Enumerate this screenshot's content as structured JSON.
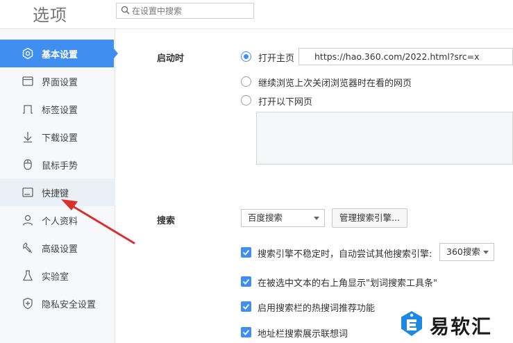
{
  "header": {
    "title": "选项",
    "search_placeholder": "在设置中搜索"
  },
  "sidebar": {
    "items": [
      {
        "label": "基本设置",
        "icon": "gear-icon"
      },
      {
        "label": "界面设置",
        "icon": "window-icon"
      },
      {
        "label": "标签设置",
        "icon": "tab-icon"
      },
      {
        "label": "下载设置",
        "icon": "download-icon"
      },
      {
        "label": "鼠标手势",
        "icon": "mouse-icon"
      },
      {
        "label": "快捷键",
        "icon": "keyboard-icon"
      },
      {
        "label": "个人资料",
        "icon": "user-icon"
      },
      {
        "label": "高级设置",
        "icon": "wrench-icon"
      },
      {
        "label": "实验室",
        "icon": "flask-icon"
      },
      {
        "label": "隐私安全设置",
        "icon": "shield-icon"
      }
    ],
    "active_index": 0
  },
  "startup": {
    "label": "启动时",
    "options": [
      {
        "label": "打开主页",
        "checked": true
      },
      {
        "label": "继续浏览上次关闭浏览器时在看的网页",
        "checked": false
      },
      {
        "label": "打开以下网页",
        "checked": false
      }
    ],
    "homepage_url": "https://hao.360.com/2022.html?src=x"
  },
  "search": {
    "label": "搜索",
    "engine_selected": "百度搜索",
    "manage_button": "管理搜索引擎...",
    "options": [
      {
        "label": "搜索引擎不稳定时，自动尝试其他搜索引擎:",
        "checked": true
      },
      {
        "label": "在被选中文本的右上角显示\"划词搜索工具条\"",
        "checked": true
      },
      {
        "label": "启用搜索栏的热搜词推荐功能",
        "checked": true
      },
      {
        "label": "地址栏搜索展示联想词",
        "checked": true
      }
    ],
    "fallback_engine": "360搜索"
  },
  "watermark": {
    "text": "易软汇"
  },
  "colors": {
    "accent": "#3f8ef0",
    "arrow": "#d9302c"
  }
}
